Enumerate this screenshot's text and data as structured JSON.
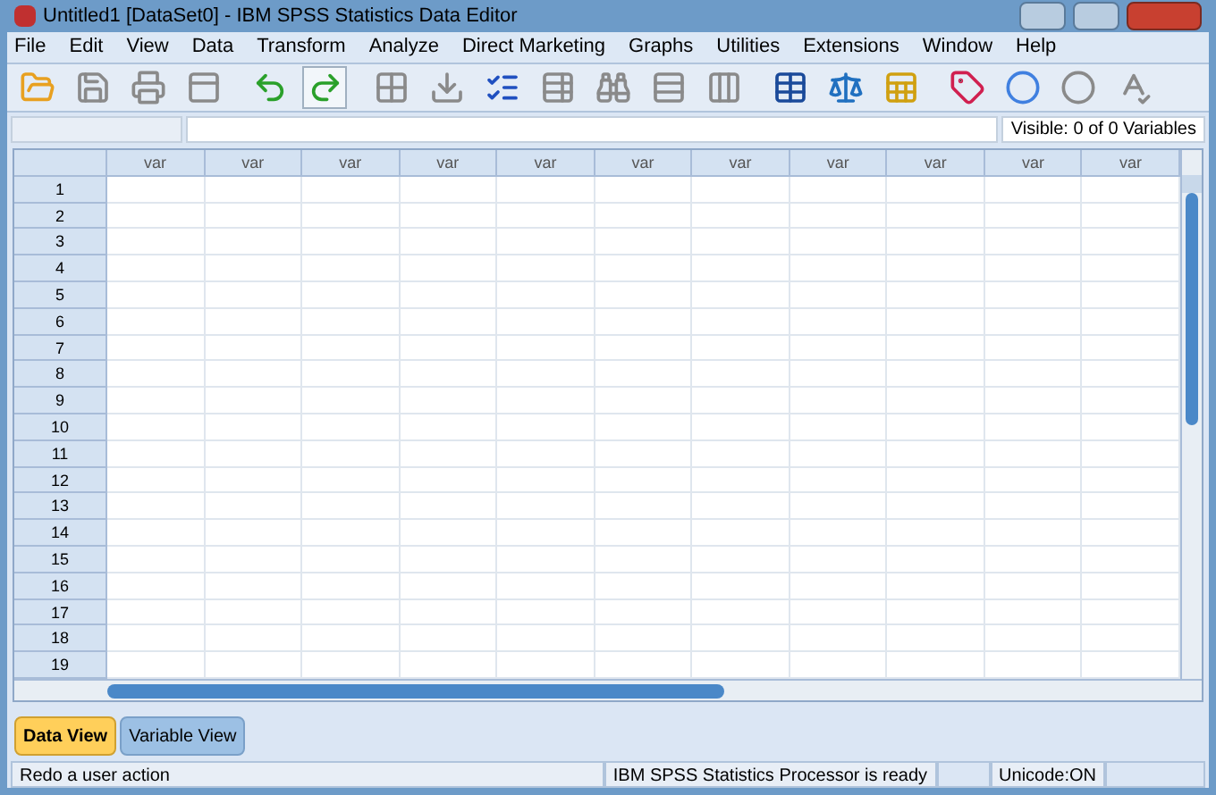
{
  "window": {
    "title": "Untitled1 [DataSet0] - IBM SPSS Statistics Data Editor"
  },
  "menu": [
    "File",
    "Edit",
    "View",
    "Data",
    "Transform",
    "Analyze",
    "Direct Marketing",
    "Graphs",
    "Utilities",
    "Extensions",
    "Window",
    "Help"
  ],
  "toolbar": [
    {
      "kind": "open",
      "disabled": false,
      "highlighted": false
    },
    {
      "kind": "save",
      "disabled": true,
      "highlighted": false
    },
    {
      "kind": "print",
      "disabled": true,
      "highlighted": false
    },
    {
      "kind": "recall",
      "disabled": true,
      "highlighted": false
    },
    {
      "kind": "undo",
      "disabled": false,
      "highlighted": false
    },
    {
      "kind": "redo",
      "disabled": false,
      "highlighted": true
    },
    {
      "kind": "goto-case",
      "disabled": true,
      "highlighted": false
    },
    {
      "kind": "goto-variable",
      "disabled": true,
      "highlighted": false
    },
    {
      "kind": "variables",
      "disabled": false,
      "highlighted": false
    },
    {
      "kind": "sheet",
      "disabled": true,
      "highlighted": false
    },
    {
      "kind": "find",
      "disabled": true,
      "highlighted": false
    },
    {
      "kind": "insert-cases",
      "disabled": true,
      "highlighted": false
    },
    {
      "kind": "insert-variable",
      "disabled": true,
      "highlighted": false
    },
    {
      "kind": "split",
      "disabled": false,
      "highlighted": false
    },
    {
      "kind": "weight",
      "disabled": false,
      "highlighted": false
    },
    {
      "kind": "select",
      "disabled": false,
      "highlighted": false
    },
    {
      "kind": "labels",
      "disabled": false,
      "highlighted": false
    },
    {
      "kind": "sets",
      "disabled": false,
      "highlighted": false
    },
    {
      "kind": "sets-all",
      "disabled": true,
      "highlighted": false
    },
    {
      "kind": "spell",
      "disabled": true,
      "highlighted": false
    }
  ],
  "visible": "Visible: 0 of 0 Variables",
  "table": {
    "columns": [
      "var",
      "var",
      "var",
      "var",
      "var",
      "var",
      "var",
      "var",
      "var",
      "var",
      "var"
    ],
    "rows": [
      "1",
      "2",
      "3",
      "4",
      "5",
      "6",
      "7",
      "8",
      "9",
      "10",
      "11",
      "12",
      "13",
      "14",
      "15",
      "16",
      "17",
      "18",
      "19"
    ]
  },
  "tabs": [
    {
      "label": "Data View",
      "selected": true
    },
    {
      "label": "Variable View",
      "selected": false
    }
  ],
  "status_bar": {
    "message": "Redo a user action",
    "processor": "IBM SPSS Statistics Processor is ready",
    "unicode": "Unicode:ON"
  }
}
